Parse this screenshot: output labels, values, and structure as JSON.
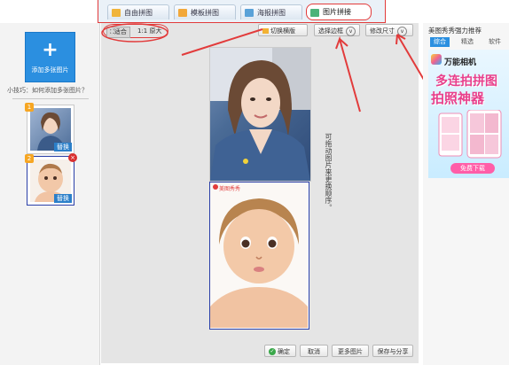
{
  "tabs": [
    {
      "label": "自由拼图",
      "icon": "free-collage-icon",
      "color": "#f0b43a"
    },
    {
      "label": "模板拼图",
      "icon": "template-icon",
      "color": "#f2a83a"
    },
    {
      "label": "海报拼图",
      "icon": "poster-icon",
      "color": "#5aa2d8"
    },
    {
      "label": "图片拼接",
      "icon": "stitch-icon",
      "color": "#4ab37a"
    }
  ],
  "sidebar": {
    "add_button": "添加多张图片",
    "tip": "小技巧：如何添加多张图片？",
    "thumbs": [
      {
        "num": "1",
        "replace": "替换"
      },
      {
        "num": "2",
        "replace": "替换"
      }
    ]
  },
  "toolbar": {
    "view_fit": "适合",
    "view_actual": "1:1 原大",
    "switch_mode": "切换横版",
    "select_border": "选择边框",
    "set_size": "修改尺寸"
  },
  "canvas": {
    "handwriting": "可拖动图片来更换顺序。",
    "watermark": "美图秀秀"
  },
  "bottom": {
    "confirm": "确定",
    "cancel": "取消",
    "more": "更多图片",
    "save": "保存与分享"
  },
  "right": {
    "title": "美图秀秀强力推荐",
    "tabs": [
      "综合",
      "精选",
      "软件"
    ],
    "ad": {
      "brand": "万能相机",
      "line1": "多连拍拼图",
      "line2": "拍照神器",
      "cta": "免费下载"
    }
  },
  "accent": "#e23b3b"
}
